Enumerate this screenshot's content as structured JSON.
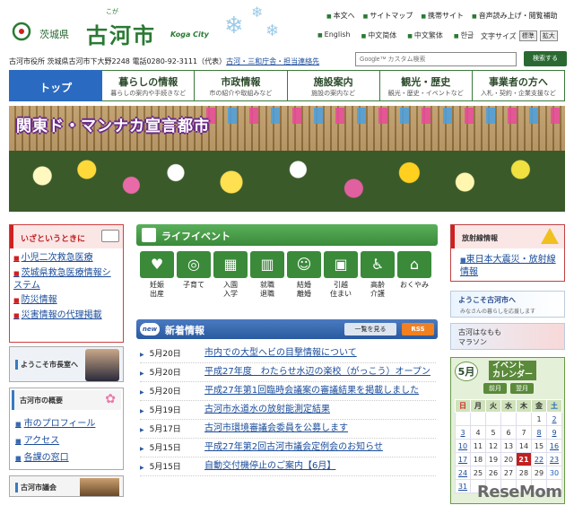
{
  "header": {
    "logo_pref": "茨城県",
    "logo_ruby": "こが",
    "logo_city": "古河市",
    "logo_en": "Koga City",
    "util_links": [
      "本文へ",
      "サイトマップ",
      "携帯サイト",
      "音声読み上げ・閲覧補助"
    ],
    "lang_links": [
      "English",
      "中文简体",
      "中文繁体",
      "한글"
    ],
    "textsize_label": "文字サイズ",
    "textsize_normal": "標準",
    "textsize_large": "拡大"
  },
  "address": {
    "text": "古河市役所 茨城県古河市下大野2248 電話0280-92-3111（代表）",
    "link": "古河・三和庁舎・担当連絡先"
  },
  "search": {
    "placeholder": "Google™ カスタム検索",
    "button": "検索する"
  },
  "nav": [
    {
      "title": "トップ",
      "sub": ""
    },
    {
      "title": "暮らしの情報",
      "sub": "暮らしの案内や手続きなど"
    },
    {
      "title": "市政情報",
      "sub": "市の紹介や取組みなど"
    },
    {
      "title": "施設案内",
      "sub": "施設の案内など"
    },
    {
      "title": "観光・歴史",
      "sub": "観光・歴史・イベントなど"
    },
    {
      "title": "事業者の方へ",
      "sub": "入札・契約・企業支援など"
    }
  ],
  "banner": {
    "title": "関東ド・マンナカ宣言都市"
  },
  "emergency": {
    "title": "いざというときに",
    "links": [
      "小児二次救急医療",
      "茨城県救急医療情報システム",
      "防災情報",
      "災害情報の代理掲載"
    ]
  },
  "mayor": {
    "label": "ようこそ市長室へ"
  },
  "overview": {
    "title": "古河市の概要",
    "links": [
      "市のプロフィール",
      "アクセス",
      "各課の窓口"
    ]
  },
  "council": {
    "label": "古河市議会"
  },
  "life_events": {
    "title": "ライフイベント",
    "items": [
      {
        "label": "妊娠\n出産",
        "icon": "pregnancy-icon",
        "glyph": "♥"
      },
      {
        "label": "子育て",
        "icon": "stroller-icon",
        "glyph": "◎"
      },
      {
        "label": "入園\n入学",
        "icon": "school-icon",
        "glyph": "▦"
      },
      {
        "label": "就職\n退職",
        "icon": "work-icon",
        "glyph": "▥"
      },
      {
        "label": "結婚\n離婚",
        "icon": "couple-icon",
        "glyph": "☺"
      },
      {
        "label": "引越\n住まい",
        "icon": "truck-icon",
        "glyph": "▣"
      },
      {
        "label": "高齢\n介護",
        "icon": "elderly-icon",
        "glyph": "♿"
      },
      {
        "label": "おくやみ",
        "icon": "condolence-icon",
        "glyph": "⌂"
      }
    ]
  },
  "news": {
    "badge": "new",
    "title": "新着情報",
    "all_button": "一覧を見る",
    "rss": "RSS",
    "items": [
      {
        "date": "5月20日",
        "text": "市内での大型ヘビの目撃情報について"
      },
      {
        "date": "5月20日",
        "text": "平成27年度　わたらせ水辺の楽校（がっこう）オープン"
      },
      {
        "date": "5月20日",
        "text": "平成27年第1回臨時会議案の審議結果を掲載しました"
      },
      {
        "date": "5月19日",
        "text": "古河市水道水の放射能測定結果"
      },
      {
        "date": "5月17日",
        "text": "古河市環境審議会委員を公募します"
      },
      {
        "date": "5月15日",
        "text": "平成27年第2回古河市議会定例会のお知らせ"
      },
      {
        "date": "5月15日",
        "text": "自動交付機停止のご案内【6月】"
      }
    ]
  },
  "radiation": {
    "title": "放射線情報",
    "link": "東日本大震災・放射線情報"
  },
  "welcome": {
    "title": "ようこそ古河市へ",
    "sub": "みなさんの暮らしを応援します"
  },
  "marathon": {
    "title": "古河はなもも\nマラソン"
  },
  "calendar": {
    "month": "5月",
    "title": "イベント\nカレンダー",
    "prev": "前月",
    "next": "翌月",
    "weekdays": [
      "日",
      "月",
      "火",
      "水",
      "木",
      "金",
      "土"
    ],
    "weeks": [
      [
        "",
        "",
        "",
        "",
        "",
        "1",
        "2"
      ],
      [
        "3",
        "4",
        "5",
        "6",
        "7",
        "8",
        "9"
      ],
      [
        "10",
        "11",
        "12",
        "13",
        "14",
        "15",
        "16"
      ],
      [
        "17",
        "18",
        "19",
        "20",
        "21",
        "22",
        "23"
      ],
      [
        "24",
        "25",
        "26",
        "27",
        "28",
        "29",
        "30"
      ],
      [
        "31",
        "",
        "",
        "",
        "",
        "",
        ""
      ]
    ],
    "today": "21",
    "event_days": [
      "2",
      "3",
      "8",
      "9",
      "10",
      "16",
      "17",
      "22",
      "23",
      "24",
      "31"
    ]
  },
  "watermark": "ReseMom",
  "colors": {
    "accent": "#2a6ac0",
    "brand_green": "#2a7a34",
    "alert_red": "#d02020"
  }
}
